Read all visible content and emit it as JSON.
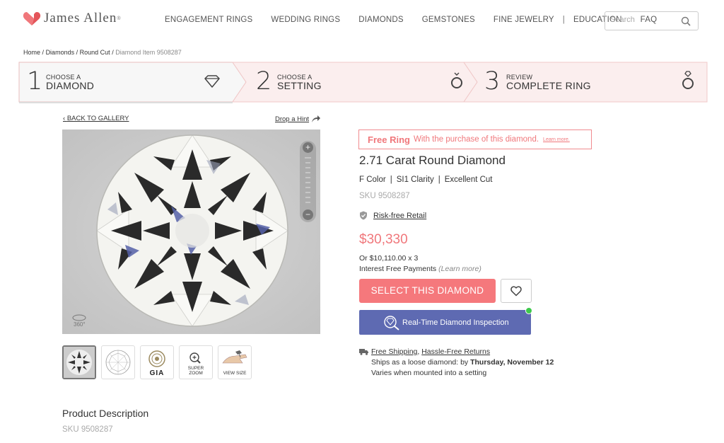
{
  "brand": {
    "name": "James Allen",
    "mark": "®"
  },
  "nav": {
    "items": [
      "ENGAGEMENT RINGS",
      "WEDDING RINGS",
      "DIAMONDS",
      "GEMSTONES",
      "FINE JEWELRY",
      "EDUCATION",
      "FAQ"
    ],
    "separator": "|"
  },
  "search": {
    "placeholder": "Search"
  },
  "breadcrumb": {
    "items": [
      "Home",
      "Diamonds",
      "Round Cut"
    ],
    "current": "Diamond Item 9508287",
    "separator": "/"
  },
  "steps": [
    {
      "number": "1",
      "small": "CHOOSE A",
      "big": "DIAMOND",
      "icon": "diamond-icon"
    },
    {
      "number": "2",
      "small": "CHOOSE A",
      "big": "SETTING",
      "icon": "ring-icon"
    },
    {
      "number": "3",
      "small": "REVIEW",
      "big": "COMPLETE RING",
      "icon": "diamond-ring-icon"
    }
  ],
  "gallery": {
    "back_label": "BACK TO GALLERY",
    "hint_label": "Drop a Hint",
    "badge_360": "360°",
    "zoom_in": "+",
    "zoom_out": "−",
    "thumbs": [
      {
        "name": "photo",
        "label": ""
      },
      {
        "name": "diagram",
        "label": ""
      },
      {
        "name": "gia",
        "label": "GIA"
      },
      {
        "name": "super-zoom",
        "label": "SUPER ZOOM"
      },
      {
        "name": "view-size",
        "label": "VIEW SIZE"
      }
    ]
  },
  "product": {
    "promo_title": "Free Ring",
    "promo_text": "With the purchase of this diamond.",
    "promo_more": "Learn more.",
    "title": "2.71 Carat Round Diamond",
    "specs": [
      "F Color",
      "SI1 Clarity",
      "Excellent Cut"
    ],
    "spec_separator": "|",
    "sku": "SKU 9508287",
    "risk_label": "Risk-free Retail",
    "price": "$30,330",
    "installment": "Or $10,110.00 x 3",
    "installment_note": "Interest Free Payments",
    "learn_more": "(Learn more)",
    "select_label": "SELECT THIS DIAMOND",
    "inspection_label": "Real-Time Diamond Inspection"
  },
  "shipping": {
    "free_shipping": "Free Shipping",
    "comma": ",",
    "returns": "Hassle-Free Returns",
    "ships_prefix": "Ships as a loose diamond: by",
    "ship_date": "Thursday, November 12",
    "setting_note": "Varies when mounted into a setting"
  },
  "description": {
    "title": "Product Description",
    "sku": "SKU 9508287"
  },
  "colors": {
    "accent": "#f5787c",
    "inspection": "#5e6ab2",
    "online_dot": "#3dc94b",
    "steps_bg": "#fbeeee"
  }
}
